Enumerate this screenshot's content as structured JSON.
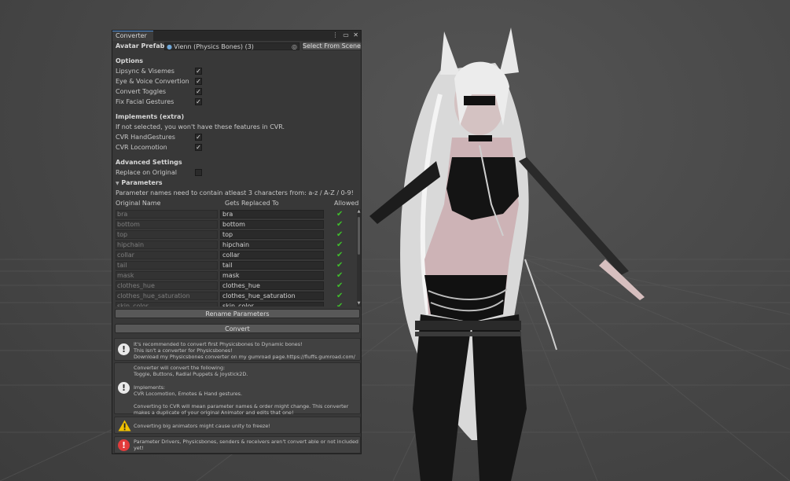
{
  "window": {
    "tab_title": "Converter",
    "tab_icons": {
      "menu": "kebab-menu-icon",
      "maximize": "maximize-icon",
      "close": "close-icon"
    }
  },
  "avatar": {
    "label": "Avatar Prefab:",
    "value": "Vienn (Physics Bones) (3)",
    "select_button": "Select From Scene"
  },
  "options": {
    "header": "Options",
    "items": [
      {
        "label": "Lipsync & Visemes",
        "checked": true
      },
      {
        "label": "Eye & Voice Convertion",
        "checked": true
      },
      {
        "label": "Convert Toggles",
        "checked": true
      },
      {
        "label": "Fix Facial Gestures",
        "checked": true
      }
    ]
  },
  "implements": {
    "header": "Implements (extra)",
    "note": "If not selected, you won't have these features in CVR.",
    "items": [
      {
        "label": "CVR HandGestures",
        "checked": true
      },
      {
        "label": "CVR Locomotion",
        "checked": true
      }
    ]
  },
  "advanced": {
    "header": "Advanced Settings",
    "replace_label": "Replace on Original",
    "replace_checked": false
  },
  "parameters": {
    "foldout_arrow": "▼",
    "header": "Parameters",
    "note": "Parameter names need to contain atleast 3 characters from: a-z / A-Z / 0-9!",
    "col_original": "Original Name",
    "col_replaced": "Gets Replaced To",
    "col_allowed": "Allowed",
    "rows": [
      {
        "original": "bra",
        "replaced": "bra",
        "allowed": "✔"
      },
      {
        "original": "bottom",
        "replaced": "bottom",
        "allowed": "✔"
      },
      {
        "original": "top",
        "replaced": "top",
        "allowed": "✔"
      },
      {
        "original": "hipchain",
        "replaced": "hipchain",
        "allowed": "✔"
      },
      {
        "original": "collar",
        "replaced": "collar",
        "allowed": "✔"
      },
      {
        "original": "tail",
        "replaced": "tail",
        "allowed": "✔"
      },
      {
        "original": "mask",
        "replaced": "mask",
        "allowed": "✔"
      },
      {
        "original": "clothes_hue",
        "replaced": "clothes_hue",
        "allowed": "✔"
      },
      {
        "original": "clothes_hue_saturation",
        "replaced": "clothes_hue_saturation",
        "allowed": "✔"
      },
      {
        "original": "skin_color",
        "replaced": "skin_color",
        "allowed": "✔"
      }
    ],
    "rename_button": "Rename Parameters"
  },
  "convert_button": "Convert",
  "messages": {
    "info1": "It's recommended to convert first Physicsbones to Dynamic bones!\nThis isn't a converter for Physicsbones!\nDownload my Physicsbones converter on my gumroad page.https://fluffs.gumroad.com/",
    "info2": "Converter will convert the following:\nToggle, Buttons, Radial Puppets & Joystick2D.\n\nImplements:\nCVR Locomotion, Emotes & Hand gestures.\n\nConverting to CVR will mean parameter names & order might change. This converter makes a duplicate of your original Animator and edits that one!",
    "warning": "Converting big animators might cause unity to freeze!",
    "error": "Parameter Drivers, Physicsbones, senders & receivers aren't convert able or not included yet!"
  },
  "colors": {
    "panel": "#383838",
    "accent_tab": "#4d8ed6",
    "allowed_check": "#3fbf2c",
    "warning": "#f2c200",
    "error": "#e23b3b",
    "scene_bg": "#4a4a4a"
  }
}
